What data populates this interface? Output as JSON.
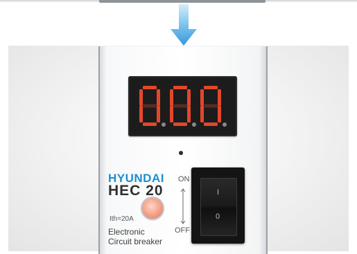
{
  "display": {
    "digits": [
      "0",
      "0",
      "0"
    ],
    "segment_color": "#e3472b"
  },
  "brand": "HYUNDAI",
  "model": "HEC 20",
  "rating": "Ith=20A",
  "description": {
    "line1": "Electronic",
    "line2": "Circuit breaker"
  },
  "switch_labels": {
    "on": "ON",
    "off": "OFF",
    "rocker_on": "I",
    "rocker_off": "0"
  },
  "colors": {
    "brand_blue": "#1b8fd0",
    "arrow_blue": "#4aa9e6",
    "led": "#f5a891"
  }
}
